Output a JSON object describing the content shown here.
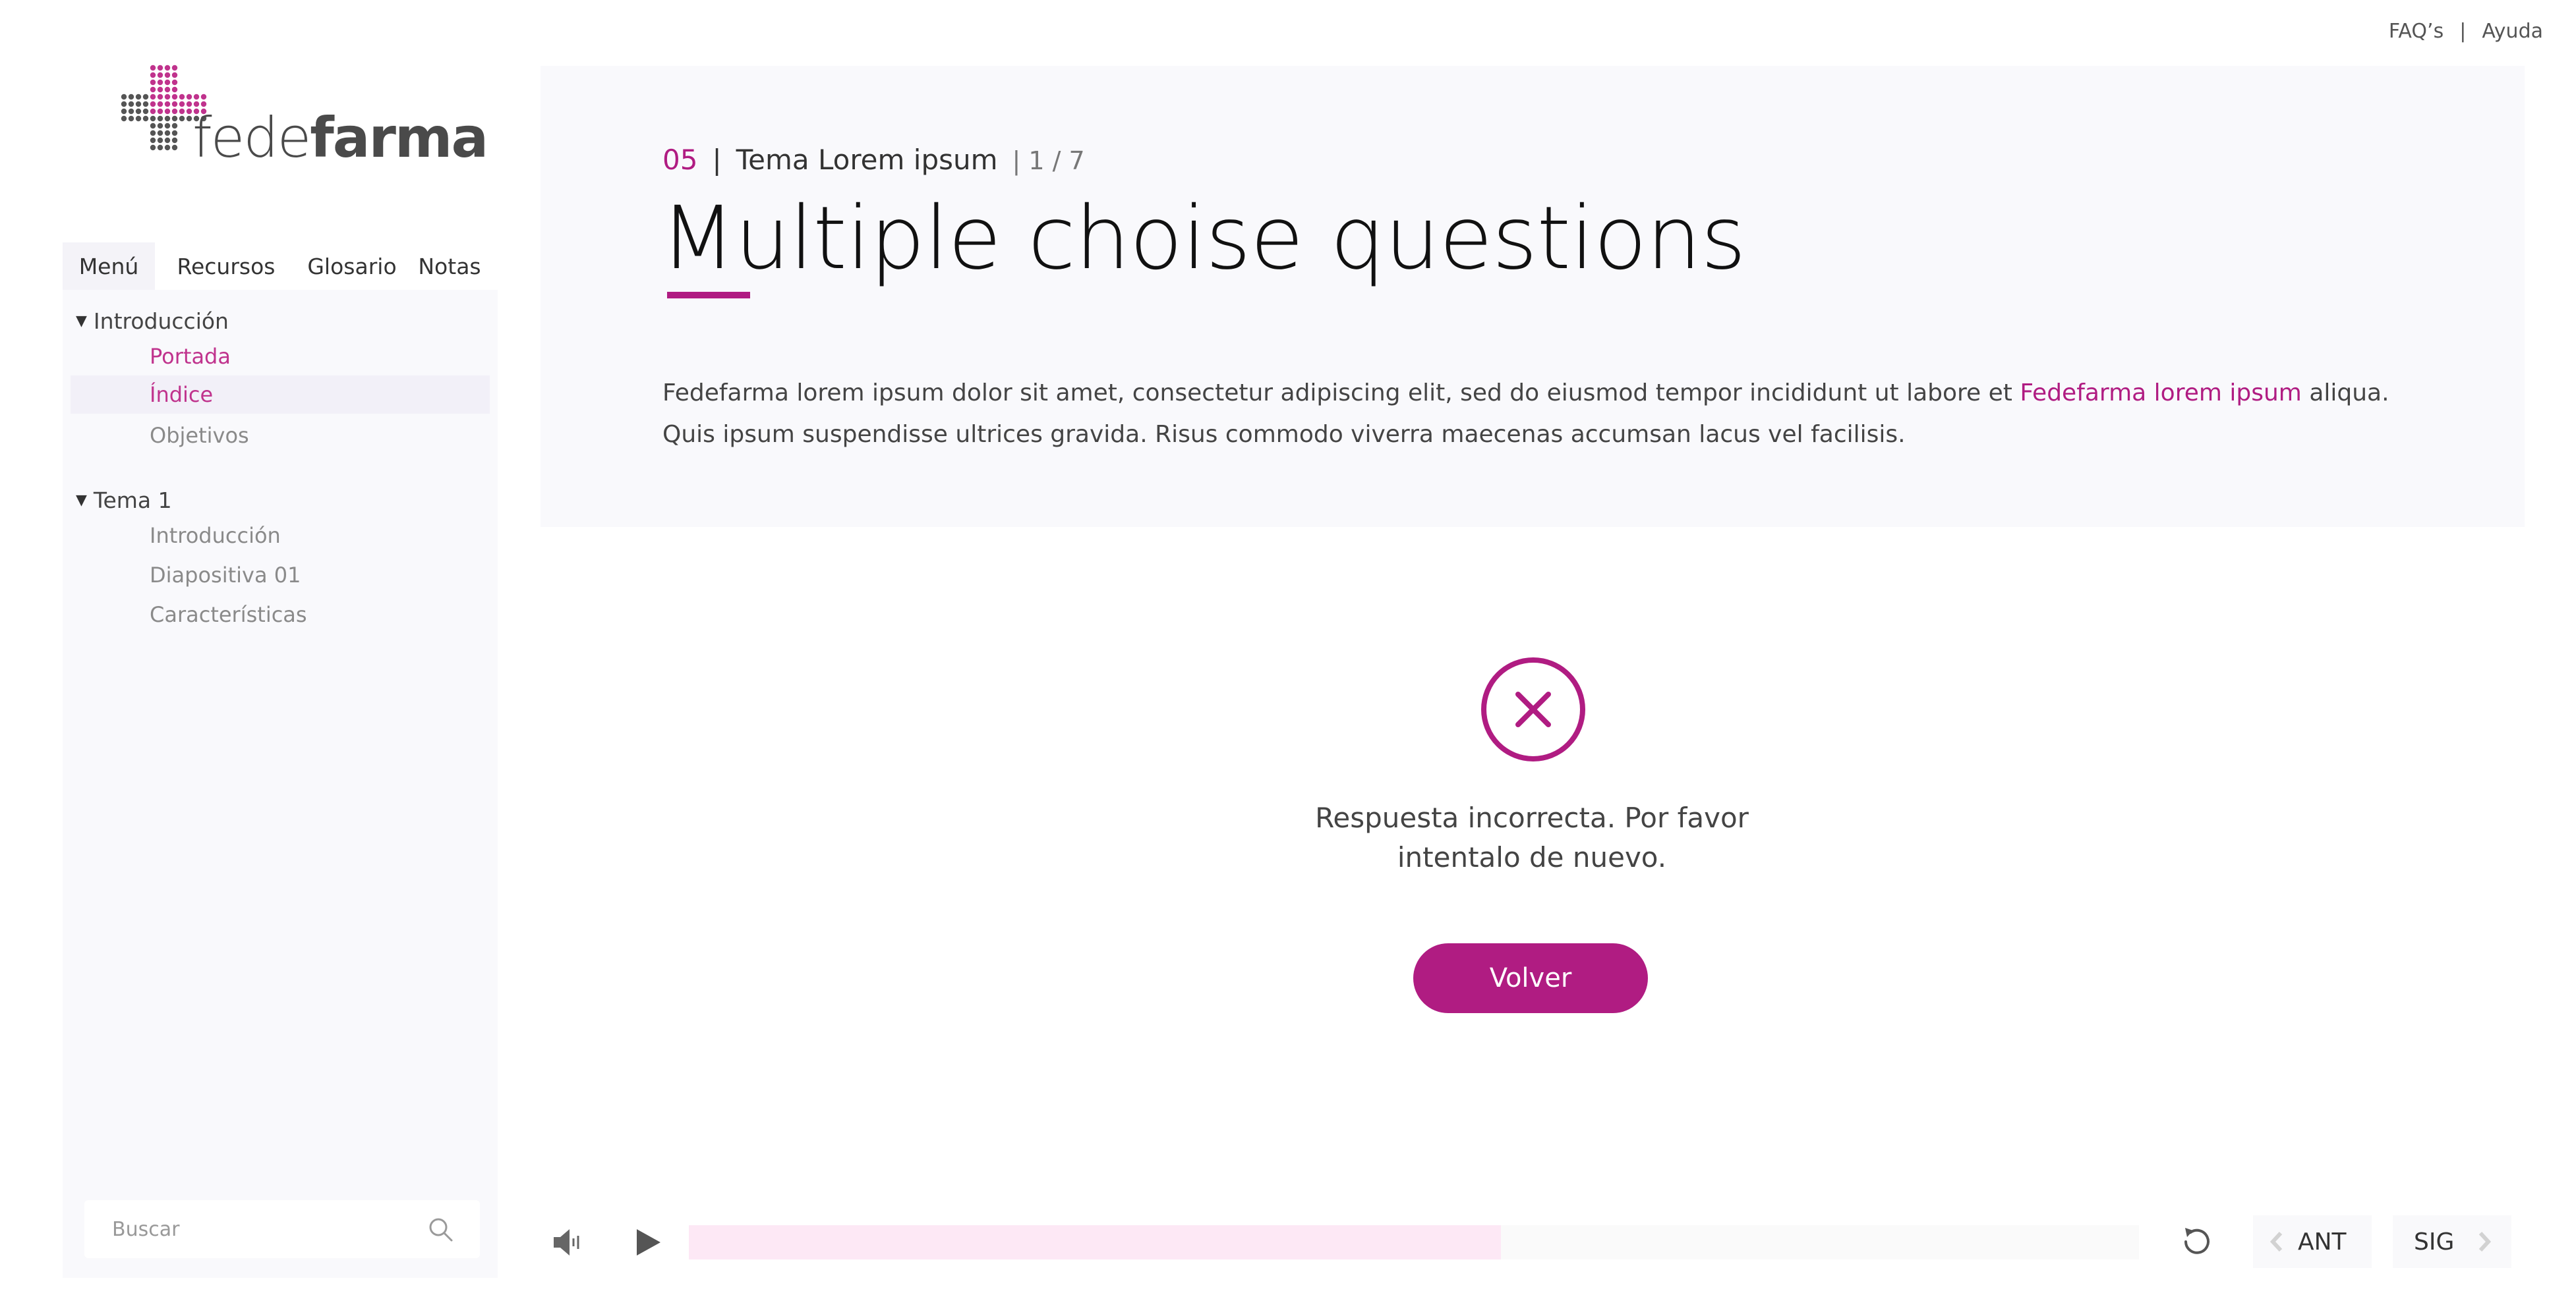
{
  "top_links": {
    "faq": "FAQ’s",
    "separator": "|",
    "help": "Ayuda"
  },
  "brand": {
    "name_light": "fede",
    "name_bold": "farma",
    "accent_color": "#b01c82"
  },
  "sidebar": {
    "tabs": [
      {
        "label": "Menú",
        "active": true
      },
      {
        "label": "Recursos",
        "active": false
      },
      {
        "label": "Glosario",
        "active": false
      },
      {
        "label": "Notas",
        "active": false
      }
    ],
    "sections": [
      {
        "title": "Introducción",
        "items": [
          {
            "label": "Portada",
            "state": "visited"
          },
          {
            "label": "Índice",
            "state": "current"
          },
          {
            "label": "Objetivos",
            "state": "default"
          }
        ]
      },
      {
        "title": "Tema 1",
        "items": [
          {
            "label": "Introducción",
            "state": "default"
          },
          {
            "label": "Diapositiva 01",
            "state": "default"
          },
          {
            "label": "Características",
            "state": "default"
          }
        ]
      }
    ],
    "search": {
      "placeholder": "Buscar",
      "icon": "search-icon"
    }
  },
  "header": {
    "number": "05",
    "separator": "|",
    "topic": "Tema Lorem ipsum",
    "pager": "| 1 / 7",
    "title": "Multiple choise questions",
    "intro_part1": "Fedefarma lorem ipsum dolor sit amet, consectetur adipiscing elit, sed do eiusmod tempor incididunt ut labore et ",
    "intro_highlight": "Fedefarma lorem ipsum",
    "intro_part2": " aliqua.",
    "intro_line2": "Quis ipsum suspendisse ultrices gravida. Risus commodo viverra maecenas accumsan lacus vel facilisis."
  },
  "feedback": {
    "icon": "close-circle-icon",
    "message_line1": "Respuesta incorrecta. Por favor",
    "message_line2": "intentalo de nuevo.",
    "button_label": "Volver"
  },
  "player": {
    "volume_icon": "volume-icon",
    "play_icon": "play-icon",
    "progress": 0.56,
    "reload_icon": "reload-icon",
    "prev_label": "ANT",
    "next_label": "SIG"
  }
}
